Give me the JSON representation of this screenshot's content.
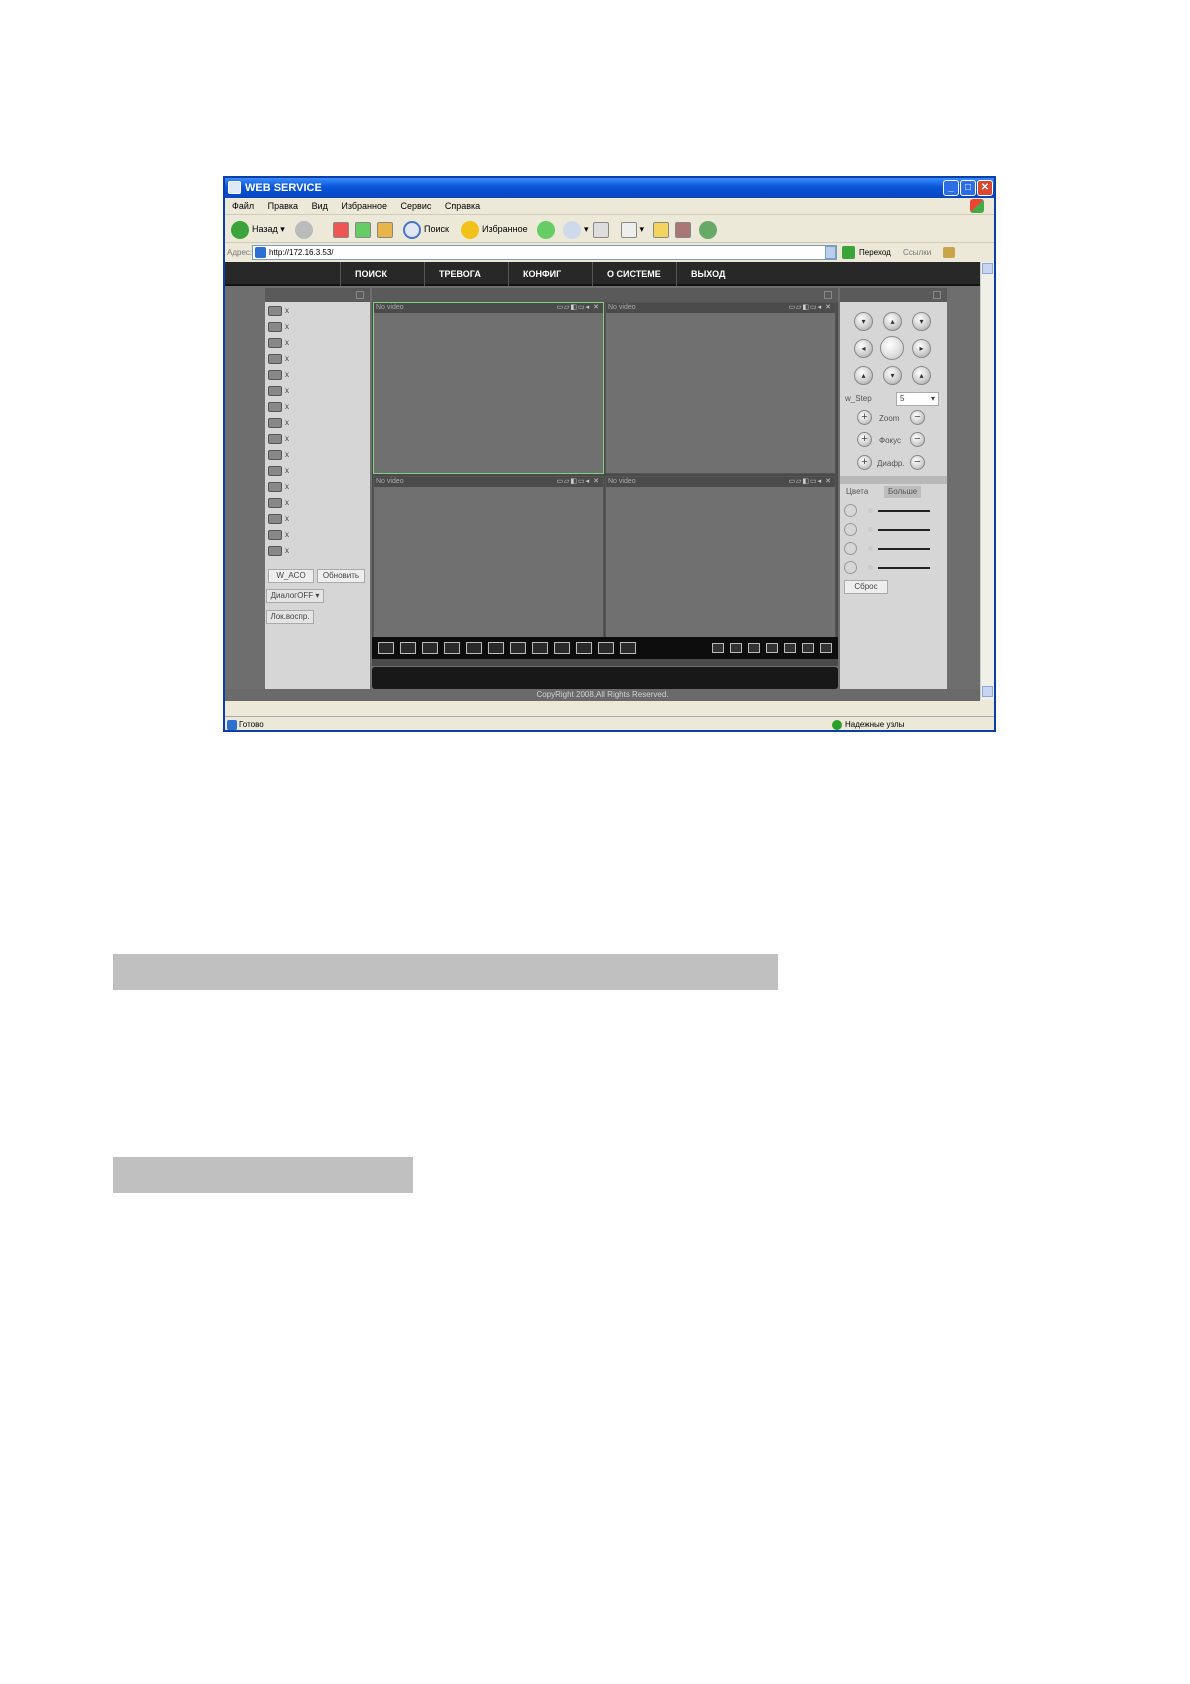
{
  "window": {
    "title": "WEB SERVICE",
    "menu": [
      "Файл",
      "Правка",
      "Вид",
      "Избранное",
      "Сервис",
      "Справка"
    ]
  },
  "toolbar": {
    "back_label": "Назад",
    "search_label": "Поиск",
    "favorites_label": "Избранное"
  },
  "address": {
    "label": "Адрес:",
    "url": "http://172.16.3.53/",
    "go_label": "Переход",
    "links_label": "Ссылки"
  },
  "nav": [
    "ПОИСК",
    "ТРЕВОГА",
    "КОНФИГ",
    "О СИСТЕМЕ",
    "ВЫХОД"
  ],
  "sidebar": {
    "cameras": [
      "x",
      "x",
      "x",
      "x",
      "x",
      "x",
      "x",
      "x",
      "x",
      "x",
      "x",
      "x",
      "x",
      "x",
      "x",
      "x"
    ],
    "buttons": [
      "W_ACO",
      "Обновить"
    ],
    "dialog_select": "ДиалогOFF",
    "playback": "Лок.воспр."
  },
  "video": {
    "cells": [
      {
        "label": "No video",
        "active": true
      },
      {
        "label": "No video",
        "active": false
      },
      {
        "label": "No video",
        "active": false
      },
      {
        "label": "No video",
        "active": false
      }
    ]
  },
  "ptz": {
    "step_label": "w_Step",
    "step_value": "5",
    "zoom_label": "Zoom",
    "focus_label": "Фокус",
    "iris_label": "Диафр.",
    "tabs": [
      "Цвета",
      "Больше"
    ],
    "reset_label": "Сброс"
  },
  "footer": {
    "copyright": "CopyRight 2008,All Rights Reserved."
  },
  "status": {
    "left": "Готово",
    "right": "Надежные узлы"
  }
}
